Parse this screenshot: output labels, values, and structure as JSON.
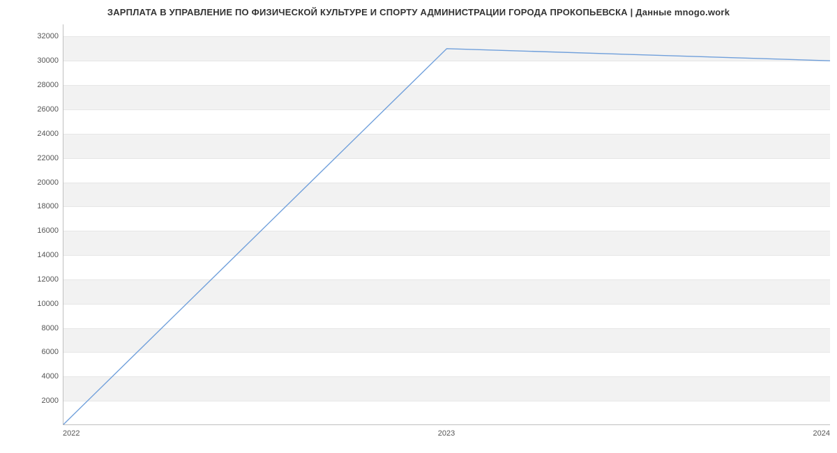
{
  "chart_data": {
    "type": "line",
    "title": "ЗАРПЛАТА В УПРАВЛЕНИЕ ПО ФИЗИЧЕСКОЙ КУЛЬТУРЕ И СПОРТУ АДМИНИСТРАЦИИ ГОРОДА ПРОКОПЬЕВСКА | Данные mnogo.work",
    "xlabel": "",
    "ylabel": "",
    "x_type": "year",
    "categories": [
      "2022",
      "2023",
      "2024"
    ],
    "x_values": [
      2022,
      2023,
      2024
    ],
    "values": [
      0,
      31000,
      30000
    ],
    "y_ticks": [
      2000,
      4000,
      6000,
      8000,
      10000,
      12000,
      14000,
      16000,
      18000,
      20000,
      22000,
      24000,
      26000,
      28000,
      30000,
      32000
    ],
    "ylim": [
      0,
      33000
    ],
    "xlim": [
      2022,
      2024
    ],
    "grid": true,
    "line_color": "#6f9fdb",
    "band_color": "#f2f2f2"
  }
}
